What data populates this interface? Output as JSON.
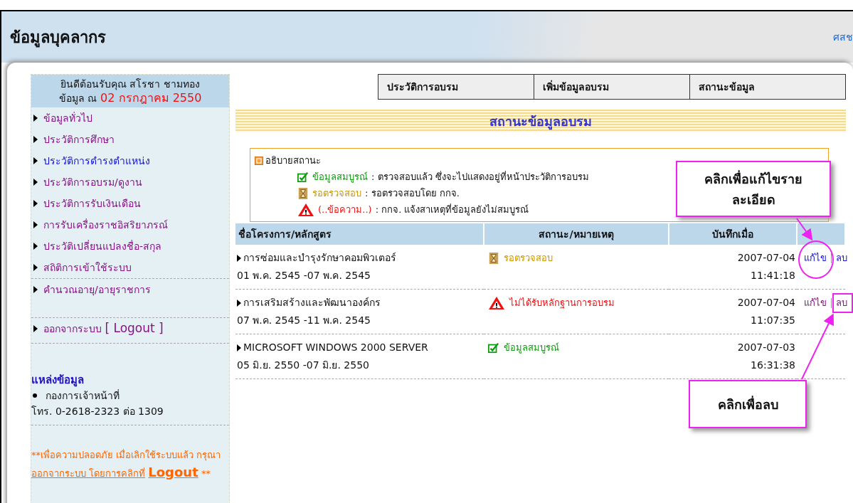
{
  "header": {
    "title": "ข้อมูลบุคลากร",
    "right_link": "ศสช"
  },
  "sidebar": {
    "welcome": "ยินดีต้อนรับคุณ สโรชา ชามทอง",
    "date_label": "ข้อมูล ณ",
    "date": "02 กรกฎาคม 2550",
    "items": [
      {
        "label": "ข้อมูลทั่วไป",
        "visited": true
      },
      {
        "label": "ประวัติการศึกษา",
        "visited": true
      },
      {
        "label": "ประวัติการดำรงตำแหน่ง",
        "visited": false
      },
      {
        "label": "ประวัติการอบรม/ดูงาน",
        "visited": true
      },
      {
        "label": "ประวัติการรับเงินเดือน",
        "visited": true
      },
      {
        "label": "การรับเครื่องราชอิสริยาภรณ์",
        "visited": true
      },
      {
        "label": "ประวัติเปลี่ยนแปลงชื่อ-สกุล",
        "visited": true
      },
      {
        "label": "สถิติการเข้าใช้ระบบ",
        "visited": true
      },
      {
        "label": "คำนวณอายุ/อายุราชการ",
        "visited": true
      }
    ],
    "logout": {
      "label": "ออกจากระบบ",
      "suffix": "[ Logout ]"
    },
    "source_title": "แหล่งข้อมูล",
    "source_org": "กองการเจ้าหน้าที่",
    "source_phone": "โทร. 0-2618-2323 ต่อ 1309",
    "note_start": "**เพื่อความปลอดภัย เมื่อเลิกใช้ระบบแล้ว กรุณา",
    "note_link": "ออกจากระบบ โดยการคลิกที่",
    "note_logout": "Logout",
    "note_end": "**"
  },
  "tabs": [
    {
      "label": "ประวัติการอบรม"
    },
    {
      "label": "เพิ่มข้อมูลอบรม"
    },
    {
      "label": "สถานะข้อมูล"
    }
  ],
  "section_title": "สถานะข้อมูลอบรม",
  "legend": {
    "title": "อธิบายสถานะ",
    "items": [
      {
        "kind": "complete",
        "label": "ข้อมูลสมบูรณ์",
        "text": ": ตรวจสอบแล้ว ซึ่งจะไปแสดงอยู่ที่หน้าประวัติการอบรม"
      },
      {
        "kind": "pending",
        "label": "รอตรวจสอบ",
        "text": ": รอตรวจสอบโดย กกจ."
      },
      {
        "kind": "incomplete",
        "label": "(..ข้อความ..)",
        "text": ": กกจ. แจ้งสาเหตุที่ข้อมูลยังไม่สมบูรณ์"
      }
    ]
  },
  "table": {
    "columns": [
      "ชื่อโครงการ/หลักสูตร",
      "สถานะ/หมายเหตุ",
      "บันทึกเมื่อ"
    ],
    "rows": [
      {
        "name": "การซ่อมและบำรุงรักษาคอมพิวเตอร์",
        "period": "01 พ.ค. 2545 -07 พ.ค. 2545",
        "kind": "pending",
        "status": "รอตรวจสอบ",
        "date": "2007-07-04",
        "time": "11:41:18",
        "actions": [
          {
            "label": "แก้ไข",
            "visited": false
          },
          {
            "label": "ลบ",
            "visited": false
          }
        ]
      },
      {
        "name": "การเสริมสร้างและพัฒนาองค์กร",
        "period": "07 พ.ค. 2545 -11 พ.ค. 2545",
        "kind": "incomplete",
        "status": "ไม่ได้รับหลักฐานการอบรม",
        "date": "2007-07-04",
        "time": "11:07:35",
        "actions": [
          {
            "label": "แก้ไข",
            "visited": true
          },
          {
            "label": "ลบ",
            "visited": true
          }
        ]
      },
      {
        "name": "MICROSOFT WINDOWS 2000 SERVER",
        "period": "05 มิ.ย. 2550 -07 มิ.ย. 2550",
        "kind": "complete",
        "status": "ข้อมูลสมบูรณ์",
        "date": "2007-07-03",
        "time": "16:31:38",
        "actions": []
      }
    ]
  },
  "callouts": [
    {
      "text": "คลิกเพื่อแก้ไขรายละเอียด"
    },
    {
      "text": "คลิกเพื่อลบ"
    }
  ]
}
